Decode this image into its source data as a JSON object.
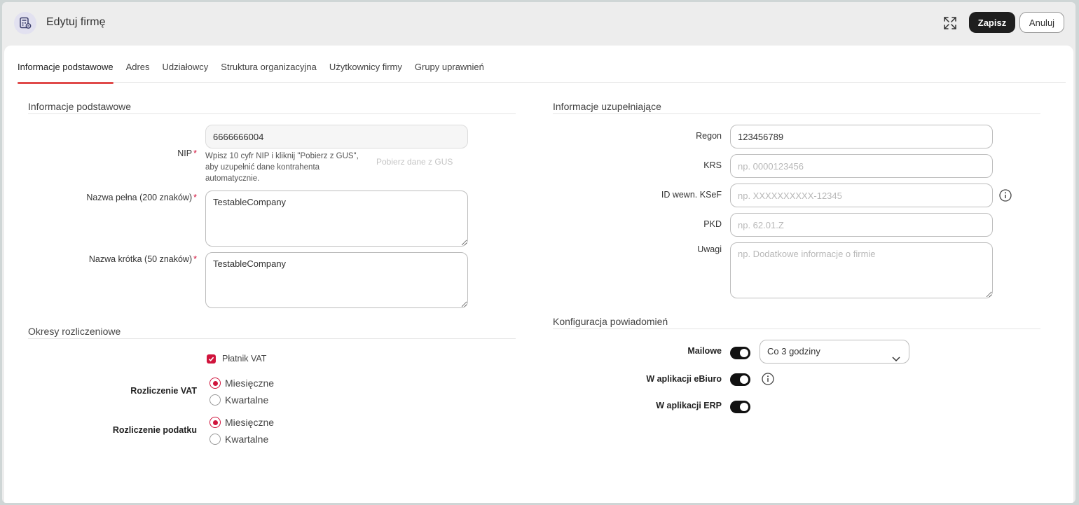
{
  "header": {
    "title": "Edytuj firmę",
    "app_icon": "calculator-document-icon",
    "expand_icon": "expand-icon",
    "save_label": "Zapisz",
    "cancel_label": "Anuluj"
  },
  "tabs": [
    {
      "label": "Informacje podstawowe",
      "active": true
    },
    {
      "label": "Adres"
    },
    {
      "label": "Udziałowcy"
    },
    {
      "label": "Struktura organizacyjna"
    },
    {
      "label": "Użytkownicy firmy"
    },
    {
      "label": "Grupy uprawnień"
    }
  ],
  "basic": {
    "section_title": "Informacje podstawowe",
    "nip_label": "NIP",
    "nip_value": "6666666004",
    "nip_hint": "Wpisz 10 cyfr NIP i kliknij \"Pobierz z GUS\", aby uzupełnić dane kontrahenta automatycznie.",
    "gus_link": "Pobierz dane z GUS",
    "full_name_label": "Nazwa pełna (200 znaków)",
    "full_name_value": "TestableCompany",
    "short_name_label": "Nazwa krótka (50 znaków)",
    "short_name_value": "TestableCompany",
    "required_mark": "*"
  },
  "periods": {
    "section_title": "Okresy rozliczeniowe",
    "vat_payer_label": "Płatnik VAT",
    "vat_payer_checked": true,
    "vat_settlement_label": "Rozliczenie VAT",
    "tax_settlement_label": "Rozliczenie podatku",
    "monthly": "Miesięczne",
    "quarterly": "Kwartalne",
    "vat_selected": "Miesięczne",
    "tax_selected": "Miesięczne"
  },
  "extra": {
    "section_title": "Informacje uzupełniające",
    "regon_label": "Regon",
    "regon_value": "123456789",
    "krs_label": "KRS",
    "krs_placeholder": "np. 0000123456",
    "ksef_label": "ID wewn. KSeF",
    "ksef_placeholder": "np. XXXXXXXXXX-12345",
    "pkd_label": "PKD",
    "pkd_placeholder": "np. 62.01.Z",
    "notes_label": "Uwagi",
    "notes_placeholder": "np. Dodatkowe informacje o firmie"
  },
  "notifications": {
    "section_title": "Konfiguracja powiadomień",
    "email_label": "Mailowe",
    "email_enabled": true,
    "email_frequency": "Co 3 godziny",
    "ebiuro_label": "W aplikacji eBiuro",
    "ebiuro_enabled": true,
    "erp_label": "W aplikacji ERP",
    "erp_enabled": true
  },
  "colors": {
    "accent": "#d0143c",
    "tab_underline": "#e04a4a",
    "primary_button": "#1e1e1e"
  }
}
